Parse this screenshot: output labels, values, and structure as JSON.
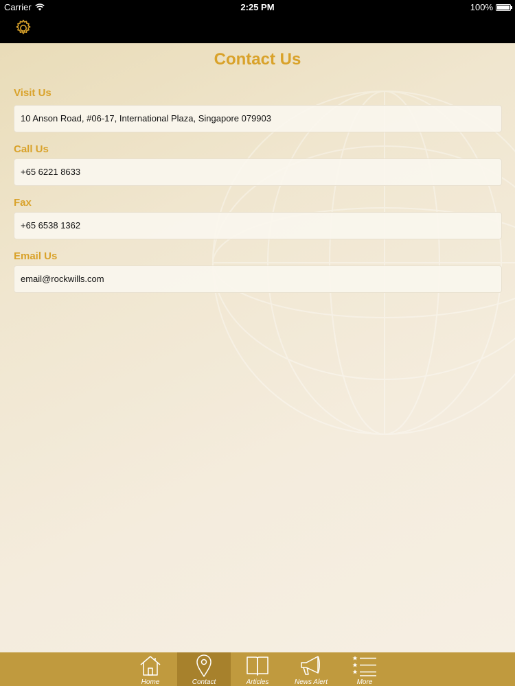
{
  "status_bar": {
    "carrier": "Carrier",
    "time": "2:25 PM",
    "battery": "100%"
  },
  "nav_bar": {
    "settings_icon": "gear-icon"
  },
  "page": {
    "title": "Contact Us"
  },
  "contact": {
    "visit": {
      "label": "Visit Us",
      "value": "10 Anson Road, #06-17, International Plaza, Singapore 079903"
    },
    "call": {
      "label": "Call Us",
      "value": "+65 6221 8633"
    },
    "fax": {
      "label": "Fax",
      "value": "+65 6538 1362"
    },
    "email": {
      "label": "Email Us",
      "value": "email@rockwills.com"
    }
  },
  "tab_bar": {
    "active": "Contact",
    "tabs": [
      {
        "label": "Home",
        "icon": "house-icon"
      },
      {
        "label": "Contact",
        "icon": "location-pin-icon"
      },
      {
        "label": "Articles",
        "icon": "open-book-icon"
      },
      {
        "label": "News Alert",
        "icon": "megaphone-icon"
      },
      {
        "label": "More",
        "icon": "star-list-icon"
      }
    ]
  },
  "colors": {
    "accent": "#d9a22a",
    "tab_bar": "#c09a3e",
    "tab_active": "#a7812c",
    "header": "#000000"
  }
}
